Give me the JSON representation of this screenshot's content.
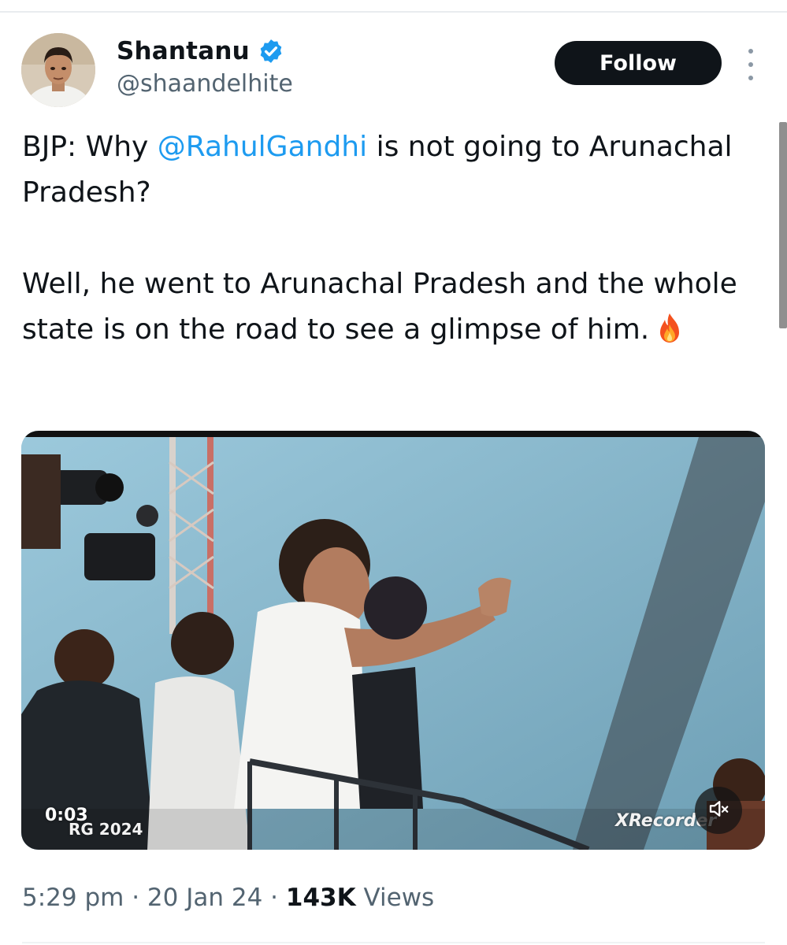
{
  "author": {
    "display_name": "Shantanu",
    "handle": "@shaandelhite",
    "verified": true
  },
  "actions": {
    "follow_label": "Follow"
  },
  "tweet": {
    "text_line1_prefix": "BJP: Why ",
    "mention": "@RahulGandhi",
    "text_line1_suffix": " is not going to Arunachal Pradesh?",
    "text_paragraph2": "Well, he went to Arunachal Pradesh and the whole state is on the road to see a glimpse of him."
  },
  "media": {
    "elapsed_time": "0:03",
    "watermark": "RG 2024",
    "recorder_watermark": "XRecorder",
    "muted": true
  },
  "meta": {
    "time": "5:29 pm",
    "separator": "·",
    "date": "20 Jan 24",
    "views_count": "143K",
    "views_label": "Views"
  },
  "colors": {
    "accent": "#1d9bf0",
    "text_primary": "#0f1419",
    "text_secondary": "#536471",
    "follow_bg": "#0f1419"
  },
  "icons": {
    "verified": "verified-badge-icon",
    "more": "more-options-icon",
    "fire": "fire-emoji-icon",
    "mute": "speaker-muted-icon"
  }
}
